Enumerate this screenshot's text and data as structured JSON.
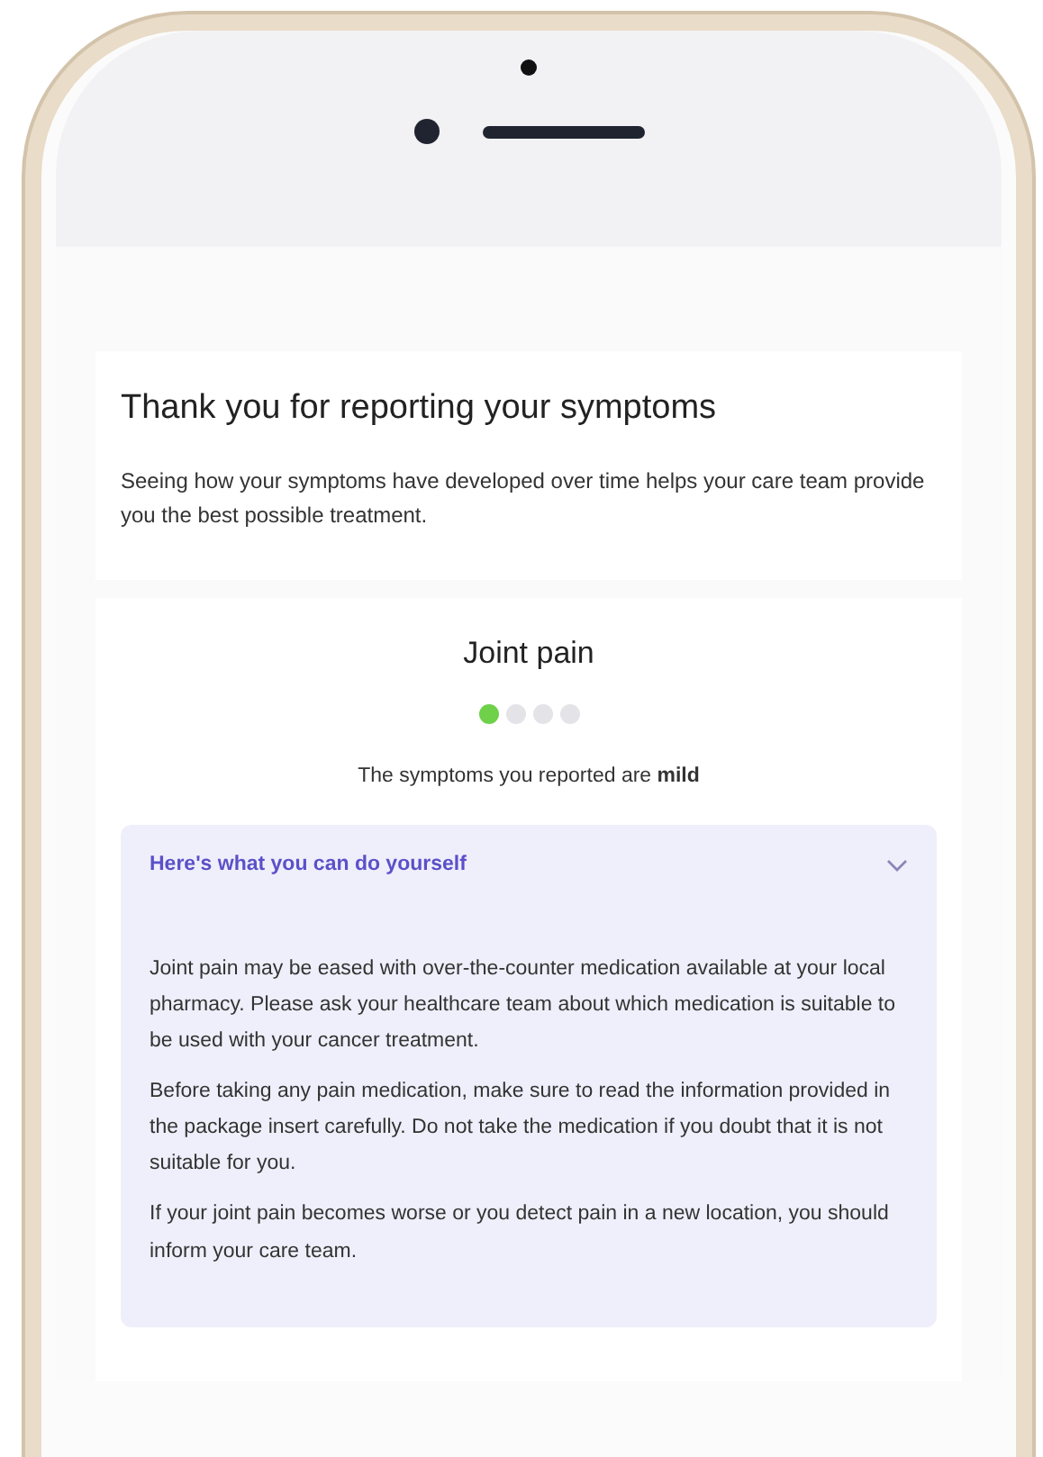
{
  "intro": {
    "title": "Thank you for reporting your symptoms",
    "text": "Seeing how your symptoms have developed over time helps your care team provide you the best possible treatment."
  },
  "symptom": {
    "name": "Joint pain",
    "severity_dots": [
      {
        "on": true
      },
      {
        "on": false
      },
      {
        "on": false
      },
      {
        "on": false
      }
    ],
    "summary": "The symptoms you reported are **mild**"
  },
  "advice": {
    "title": "Here's what you can do yourself",
    "expanded": true,
    "paragraphs": [
      "Joint pain may be eased with over-the-counter medication available at your local pharmacy. Please ask your healthcare team about which medication is suitable to be used with your cancer treatment.",
      "Before taking any pain medication, make sure to read the information provided in the package insert carefully. Do not take the medication if you doubt that it is not suitable for you.",
      "If your joint pain becomes worse or you detect pain in a new location, you should inform your care team."
    ]
  }
}
